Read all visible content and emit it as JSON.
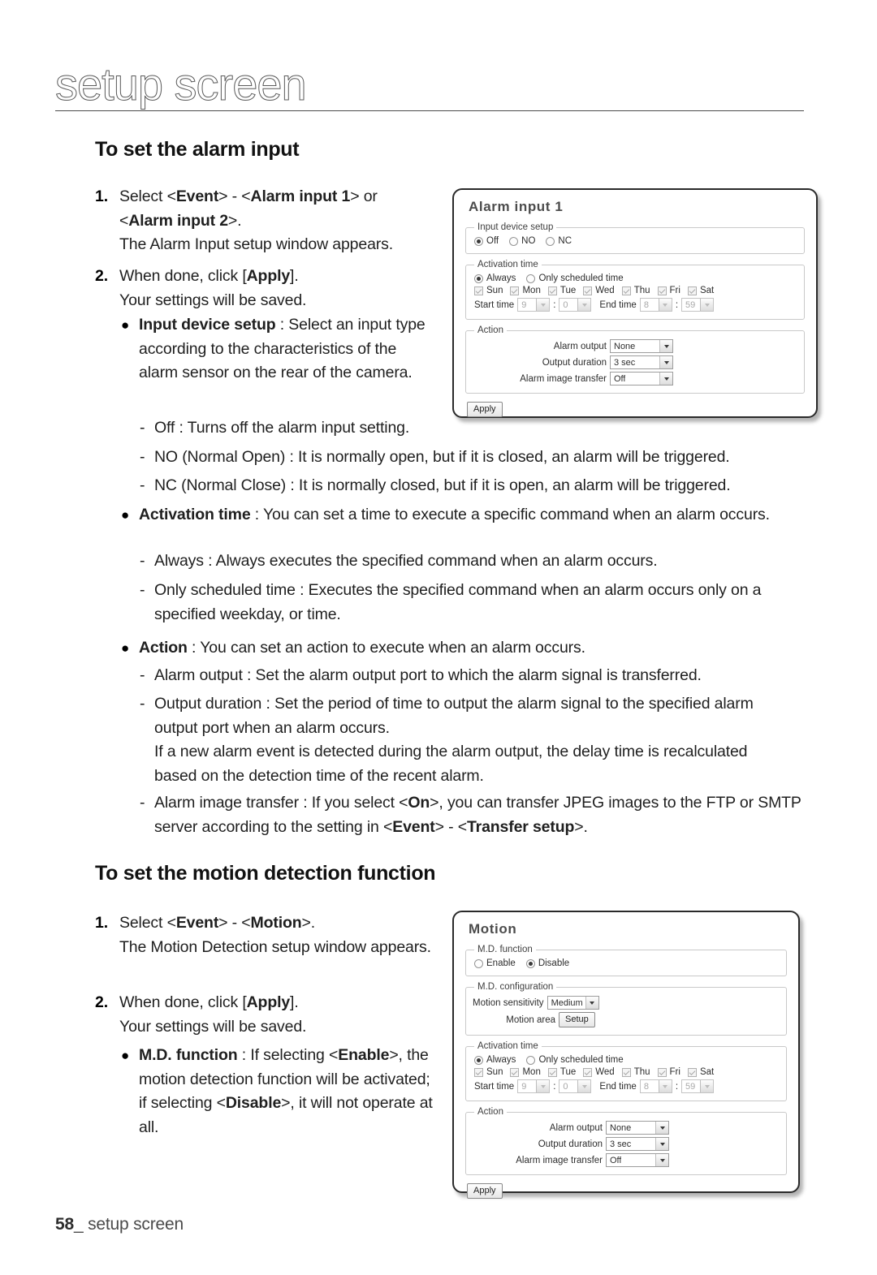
{
  "header": {
    "title": "setup screen"
  },
  "footer": {
    "page_number": "58",
    "separator": "_",
    "label": "setup screen"
  },
  "sections": {
    "alarm": {
      "heading": "To set the alarm input",
      "step1": {
        "number": "1.",
        "line1_pre": "Select <",
        "line1_b1": "Event",
        "line1_mid": "> - <",
        "line1_b2": "Alarm input 1",
        "line1_post": "> or",
        "line2_pre": "<",
        "line2_b": "Alarm input 2",
        "line2_post": ">.",
        "line3": "The Alarm Input setup window appears."
      },
      "step2": {
        "number": "2.",
        "line1_pre": "When done, click [",
        "line1_b": "Apply",
        "line1_post": "].",
        "line2": "Your settings will be saved."
      },
      "bullet_input_device": {
        "bullet": "●",
        "term": "Input device setup",
        "text": " : Select an input type according to the characteristics of the alarm sensor on the rear of the camera."
      },
      "dash_off": {
        "dash": "-",
        "text": "Off : Turns off the alarm input setting."
      },
      "dash_no": {
        "dash": "-",
        "text": "NO (Normal Open) : It is normally open, but if it is closed, an alarm will be triggered."
      },
      "dash_nc": {
        "dash": "-",
        "text": "NC (Normal Close) : It is normally closed, but if it is open, an alarm will be triggered."
      },
      "bullet_activation": {
        "bullet": "●",
        "term": "Activation time",
        "text": " : You can set a time to execute a specific command when an alarm occurs."
      },
      "dash_always": {
        "dash": "-",
        "text": "Always : Always executes the specified command when an alarm occurs."
      },
      "dash_scheduled": {
        "dash": "-",
        "text": "Only scheduled time : Executes the specified command when an alarm occurs only on a specified weekday, or time."
      },
      "bullet_action": {
        "bullet": "●",
        "term": "Action",
        "text": " : You can set an action to execute when an alarm occurs."
      },
      "dash_alarm_output": {
        "dash": "-",
        "text": "Alarm output : Set the alarm output port to which the alarm signal is transferred."
      },
      "dash_output_duration": {
        "dash": "-",
        "text": "Output duration : Set the period of time to output the alarm signal to the specified alarm output port when an alarm occurs.",
        "text2": "If a new alarm event is detected during the alarm output, the delay time is recalculated based on the detection time of the recent alarm."
      },
      "dash_image_transfer": {
        "dash": "-",
        "pre": "Alarm image transfer : If you select <",
        "b1": "On",
        "mid": ">, you can transfer JPEG images to the FTP or SMTP server according to the setting in <",
        "b2": "Event",
        "mid2": "> - <",
        "b3": "Transfer setup",
        "post": ">."
      }
    },
    "motion": {
      "heading": "To set the motion detection function",
      "step1": {
        "number": "1.",
        "line1_pre": "Select <",
        "line1_b1": "Event",
        "line1_mid": "> - <",
        "line1_b2": "Motion",
        "line1_post": ">.",
        "line2": "The Motion Detection setup window appears."
      },
      "step2": {
        "number": "2.",
        "line1_pre": "When done, click [",
        "line1_b": "Apply",
        "line1_post": "].",
        "line2": "Your settings will be saved."
      },
      "bullet_md_function": {
        "bullet": "●",
        "term": "M.D. function",
        "pre": " : If selecting <",
        "b1": "Enable",
        "mid": ">, the motion detection function will be activated; if selecting <",
        "b2": "Disable",
        "post": ">, it will not operate at all."
      }
    }
  },
  "alarm_dialog": {
    "title": "Alarm input 1",
    "input_device_setup": {
      "legend": "Input device setup",
      "options": [
        {
          "label": "Off",
          "selected": true
        },
        {
          "label": "NO",
          "selected": false
        },
        {
          "label": "NC",
          "selected": false
        }
      ]
    },
    "activation_time": {
      "legend": "Activation time",
      "mode_options": [
        {
          "label": "Always",
          "selected": true
        },
        {
          "label": "Only scheduled time",
          "selected": false
        }
      ],
      "days": [
        {
          "label": "Sun",
          "checked": true
        },
        {
          "label": "Mon",
          "checked": true
        },
        {
          "label": "Tue",
          "checked": true
        },
        {
          "label": "Wed",
          "checked": true
        },
        {
          "label": "Thu",
          "checked": true
        },
        {
          "label": "Fri",
          "checked": true
        },
        {
          "label": "Sat",
          "checked": true
        }
      ],
      "start_label": "Start time",
      "start_hour": "9",
      "start_minute": "0",
      "end_label": "End time",
      "end_hour": "8",
      "end_minute": "59",
      "colon": ":"
    },
    "action": {
      "legend": "Action",
      "alarm_output_label": "Alarm output",
      "alarm_output_value": "None",
      "output_duration_label": "Output duration",
      "output_duration_value": "3 sec",
      "alarm_image_transfer_label": "Alarm image transfer",
      "alarm_image_transfer_value": "Off"
    },
    "apply_label": "Apply"
  },
  "motion_dialog": {
    "title": "Motion",
    "md_function": {
      "legend": "M.D. function",
      "options": [
        {
          "label": "Enable",
          "selected": false
        },
        {
          "label": "Disable",
          "selected": true
        }
      ]
    },
    "md_configuration": {
      "legend": "M.D. configuration",
      "sensitivity_label": "Motion sensitivity",
      "sensitivity_value": "Medium",
      "area_label": "Motion area",
      "area_button": "Setup"
    },
    "activation_time": {
      "legend": "Activation time",
      "mode_options": [
        {
          "label": "Always",
          "selected": true
        },
        {
          "label": "Only scheduled time",
          "selected": false
        }
      ],
      "days": [
        {
          "label": "Sun",
          "checked": true
        },
        {
          "label": "Mon",
          "checked": true
        },
        {
          "label": "Tue",
          "checked": true
        },
        {
          "label": "Wed",
          "checked": true
        },
        {
          "label": "Thu",
          "checked": true
        },
        {
          "label": "Fri",
          "checked": true
        },
        {
          "label": "Sat",
          "checked": true
        }
      ],
      "start_label": "Start time",
      "start_hour": "9",
      "start_minute": "0",
      "end_label": "End time",
      "end_hour": "8",
      "end_minute": "59",
      "colon": ":"
    },
    "action": {
      "legend": "Action",
      "alarm_output_label": "Alarm output",
      "alarm_output_value": "None",
      "output_duration_label": "Output duration",
      "output_duration_value": "3 sec",
      "alarm_image_transfer_label": "Alarm image transfer",
      "alarm_image_transfer_value": "Off"
    },
    "apply_label": "Apply"
  }
}
